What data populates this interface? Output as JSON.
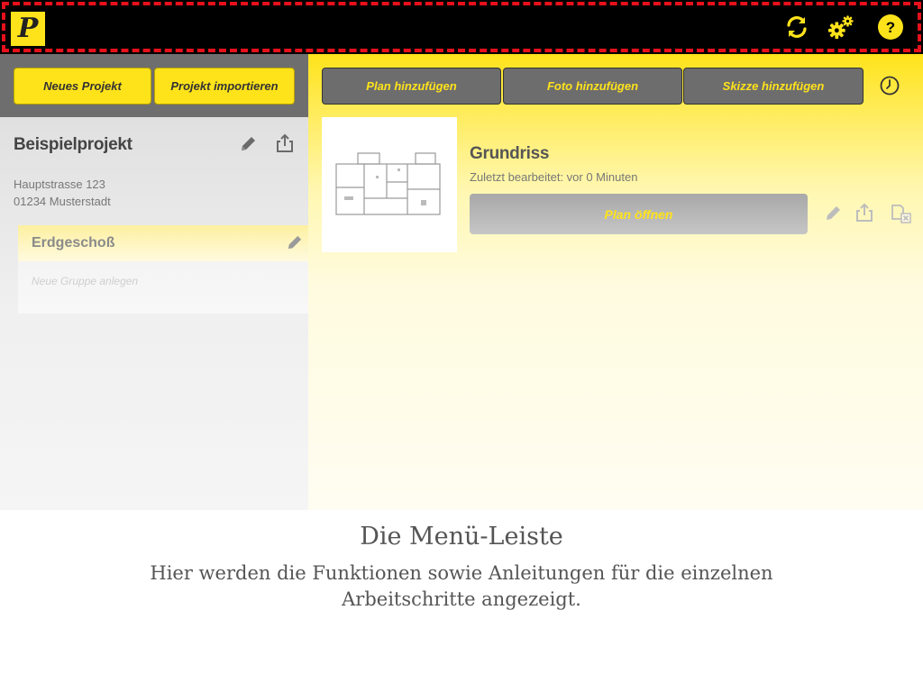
{
  "app": {
    "logo_letter": "P",
    "accent_color": "#ffe31a",
    "highlight_color": "#e8101a"
  },
  "topbar": {
    "icons": [
      "sync-icon",
      "settings-icon",
      "help-icon"
    ],
    "help_glyph": "?"
  },
  "sidebar": {
    "new_project_label": "Neues Projekt",
    "import_project_label": "Projekt importieren",
    "project": {
      "title": "Beispielprojekt",
      "address_line1": "Hauptstrasse 123",
      "address_line2": "01234 Musterstadt"
    },
    "groups": [
      {
        "label": "Erdgeschoß"
      }
    ],
    "new_group_placeholder": "Neue Gruppe anlegen"
  },
  "main": {
    "add_plan_label": "Plan hinzufügen",
    "add_photo_label": "Foto hinzufügen",
    "add_sketch_label": "Skizze hinzufügen",
    "plans": [
      {
        "name": "Grundriss",
        "last_edited": "Zuletzt bearbeitet: vor 0 Minuten",
        "open_label": "Plan öffnen"
      }
    ]
  },
  "caption": {
    "title": "Die Menü-Leiste",
    "text": "Hier werden die Funktionen sowie Anleitungen für die einzelnen Arbeitschritte angezeigt."
  }
}
